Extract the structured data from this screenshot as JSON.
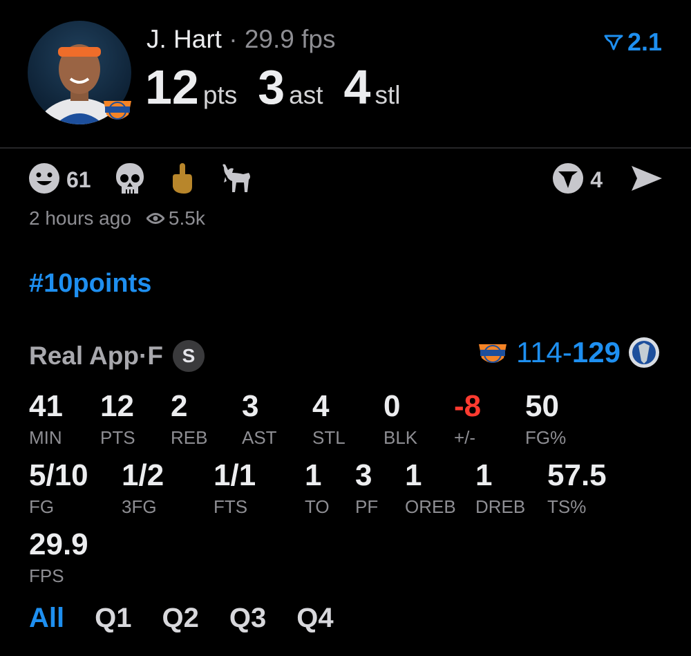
{
  "header": {
    "player_name": "J. Hart",
    "separator": " · ",
    "fps_text": "29.9 fps",
    "points": "12",
    "points_unit": "pts",
    "assists": "3",
    "assists_unit": "ast",
    "steals": "4",
    "steals_unit": "stl",
    "rating": "2.1"
  },
  "reactions": {
    "smile_count": "61",
    "comments_count": "4",
    "icons": [
      "smile-icon",
      "skull-icon",
      "middle-finger-icon",
      "goat-icon",
      "comment-icon",
      "share-icon"
    ]
  },
  "meta": {
    "time_ago": "2 hours ago",
    "views": "5.5k"
  },
  "hashtag": "#10points",
  "game": {
    "source": "Real App",
    "dot": " · ",
    "status": "F",
    "badge": "S",
    "score_home": "114",
    "score_dash": "-",
    "score_away": "129"
  },
  "stats_row1": [
    {
      "value": "41",
      "label": "MIN"
    },
    {
      "value": "12",
      "label": "PTS"
    },
    {
      "value": "2",
      "label": "REB"
    },
    {
      "value": "3",
      "label": "AST"
    },
    {
      "value": "4",
      "label": "STL"
    },
    {
      "value": "0",
      "label": "BLK"
    },
    {
      "value": "-8",
      "label": "+/-"
    },
    {
      "value": "50",
      "label": "FG%"
    }
  ],
  "stats_row2": [
    {
      "value": "5/10",
      "label": "FG"
    },
    {
      "value": "1/2",
      "label": "3FG"
    },
    {
      "value": "1/1",
      "label": "FTS"
    },
    {
      "value": "1",
      "label": "TO"
    },
    {
      "value": "3",
      "label": "PF"
    },
    {
      "value": "1",
      "label": "OREB"
    },
    {
      "value": "1",
      "label": "DREB"
    },
    {
      "value": "57.5",
      "label": "TS%"
    }
  ],
  "stats_row3": [
    {
      "value": "29.9",
      "label": "FPS"
    }
  ],
  "quarters": [
    "All",
    "Q1",
    "Q2",
    "Q3",
    "Q4"
  ],
  "colors": {
    "accent": "#1e8ff0",
    "negative": "#ff3b30",
    "muted": "#8e8e93",
    "background": "#000000"
  }
}
